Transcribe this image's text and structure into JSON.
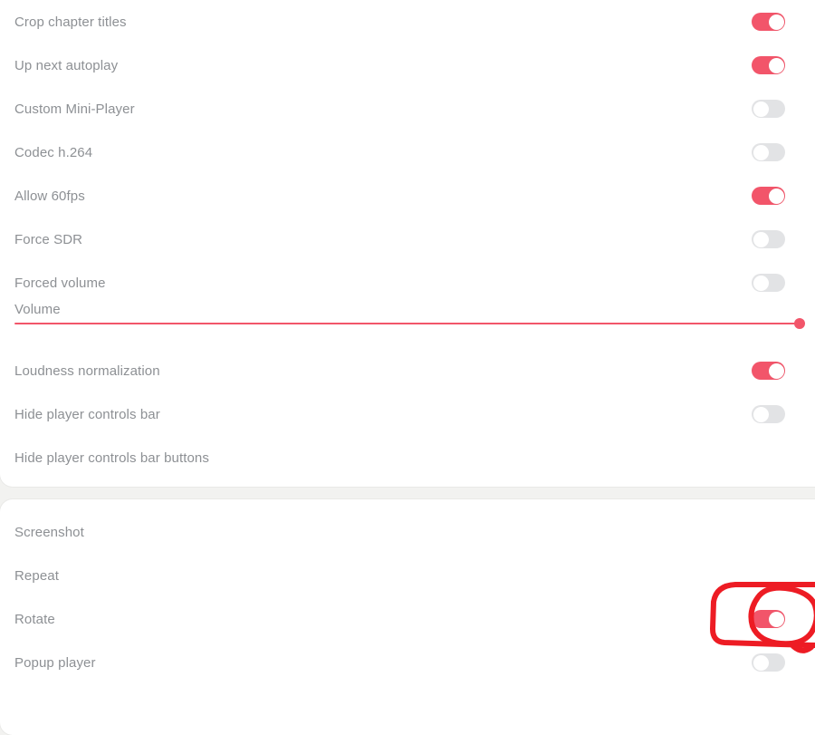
{
  "app": {
    "theme_accent": "#f2556a",
    "toggle_off_color": "#e2e3e5",
    "label_color": "#8d9094",
    "card_background": "#ffffff",
    "page_background": "#f2f2f0",
    "annotation_color": "#ed1c24"
  },
  "sections": [
    {
      "id": "player-settings",
      "rows": [
        {
          "label": "Crop chapter titles",
          "control": "toggle",
          "state": "on"
        },
        {
          "label": "Up next autoplay",
          "control": "toggle",
          "state": "on"
        },
        {
          "label": "Custom Mini-Player",
          "control": "toggle",
          "state": "off"
        },
        {
          "label": "Codec h.264",
          "control": "toggle",
          "state": "off"
        },
        {
          "label": "Allow 60fps",
          "control": "toggle",
          "state": "on"
        },
        {
          "label": "Force SDR",
          "control": "toggle",
          "state": "off"
        },
        {
          "label": "Forced volume",
          "control": "toggle",
          "state": "off"
        },
        {
          "label": "Volume",
          "control": "slider",
          "value": 100,
          "min": 0,
          "max": 100
        },
        {
          "label": "Loudness normalization",
          "control": "toggle",
          "state": "on"
        },
        {
          "label": "Hide player controls bar",
          "control": "toggle",
          "state": "off"
        },
        {
          "label": "Hide player controls bar buttons",
          "control": "none"
        }
      ]
    },
    {
      "id": "player-actions",
      "rows": [
        {
          "label": "Screenshot",
          "control": "none"
        },
        {
          "label": "Repeat",
          "control": "none"
        },
        {
          "label": "Rotate",
          "control": "toggle",
          "state": "on",
          "annotated": true
        },
        {
          "label": "Popup player",
          "control": "toggle",
          "state": "off"
        }
      ]
    }
  ],
  "annotation": {
    "kind": "hand-drawn-highlight",
    "shapes": [
      "rounded-rectangle",
      "oval"
    ],
    "target": "Rotate"
  }
}
